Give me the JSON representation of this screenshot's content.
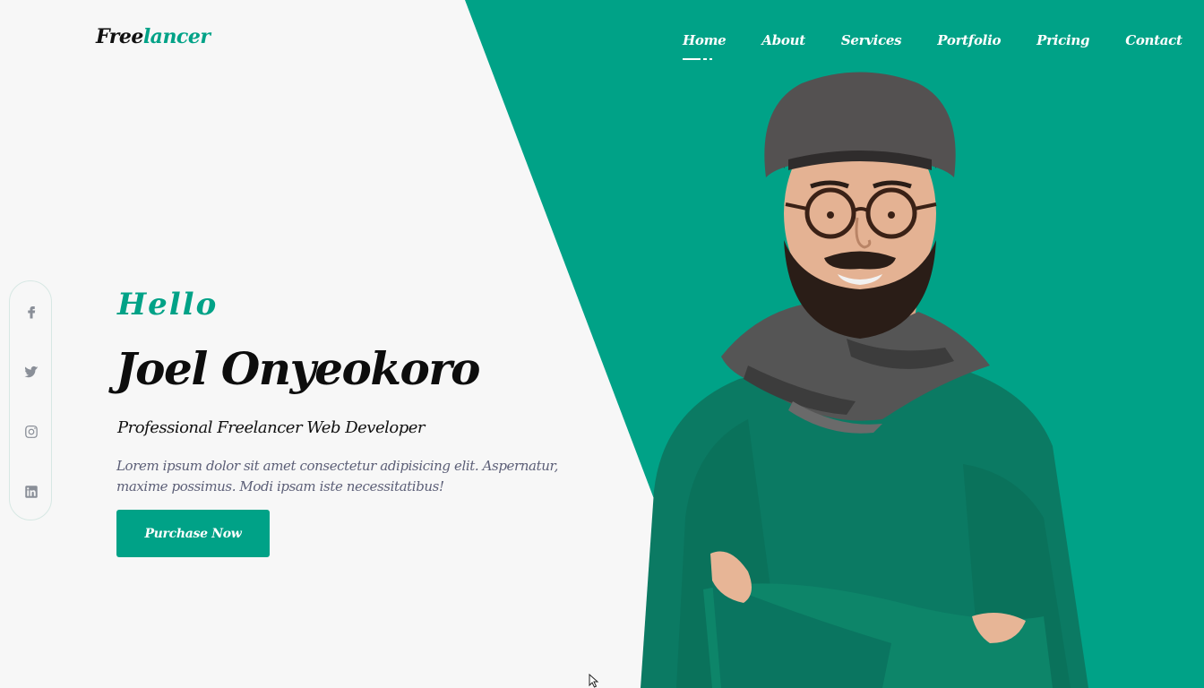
{
  "brand": {
    "part1": "Free",
    "part2": "lancer"
  },
  "nav": {
    "items": [
      {
        "label": "Home",
        "active": true
      },
      {
        "label": "About"
      },
      {
        "label": "Services"
      },
      {
        "label": "Portfolio"
      },
      {
        "label": "Pricing"
      },
      {
        "label": "Contact"
      }
    ]
  },
  "social": [
    {
      "icon": "facebook-icon"
    },
    {
      "icon": "twitter-icon"
    },
    {
      "icon": "instagram-icon"
    },
    {
      "icon": "linkedin-icon"
    }
  ],
  "hero": {
    "greeting": "Hello",
    "name": "Joel Onyeokoro",
    "title": "Professional Freelancer Web Developer",
    "description": "Lorem ipsum dolor sit amet consectetur adipisicing elit. Aspernatur, maxime possimus. Modi ipsam iste necessitatibus!",
    "cta_label": "Purchase Now"
  },
  "colors": {
    "accent": "#00a287",
    "background": "#f7f7f7",
    "text_dark": "#0d0d0d",
    "text_muted": "#5c5f77"
  }
}
